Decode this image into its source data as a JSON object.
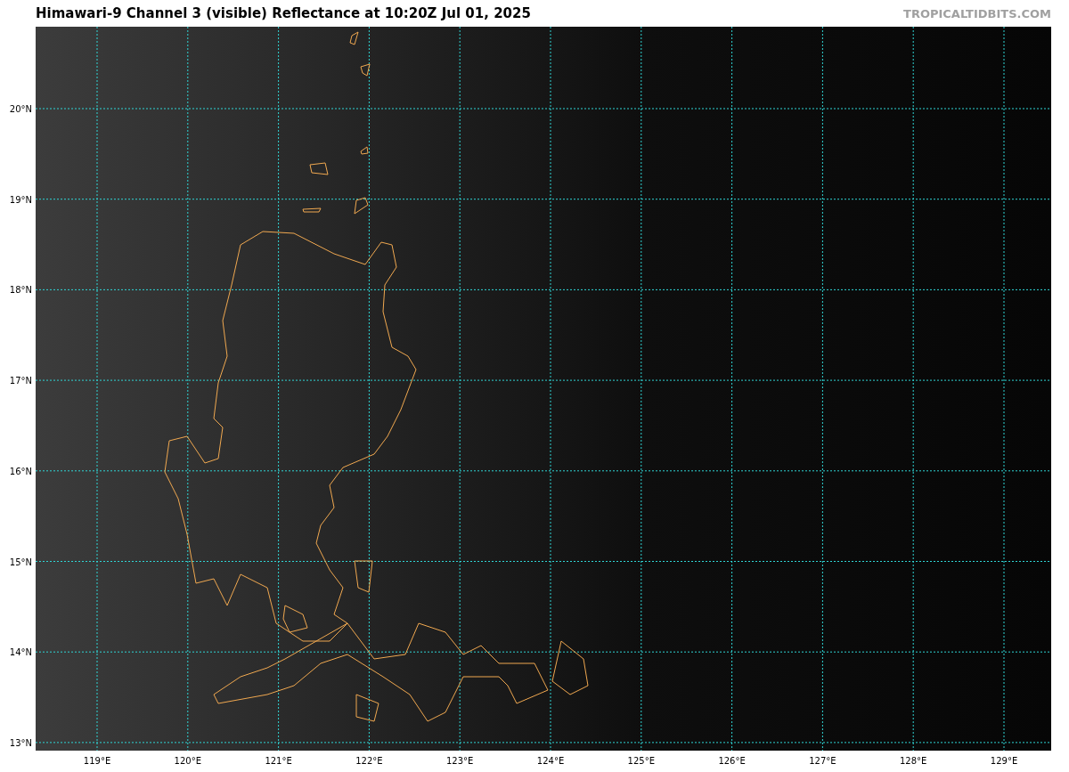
{
  "title": "Himawari-9 Channel 3 (visible) Reflectance at 10:20Z Jul 01, 2025",
  "credit": "TROPICALTIDBITS.COM",
  "map": {
    "lat_labels": [
      "20°N",
      "19°N",
      "18°N",
      "17°N",
      "16°N",
      "15°N",
      "14°N",
      "13°N"
    ],
    "lon_labels": [
      "119°E",
      "120°E",
      "121°E",
      "122°E",
      "123°E",
      "124°E",
      "125°E",
      "126°E",
      "127°E",
      "128°E",
      "129°E"
    ]
  }
}
